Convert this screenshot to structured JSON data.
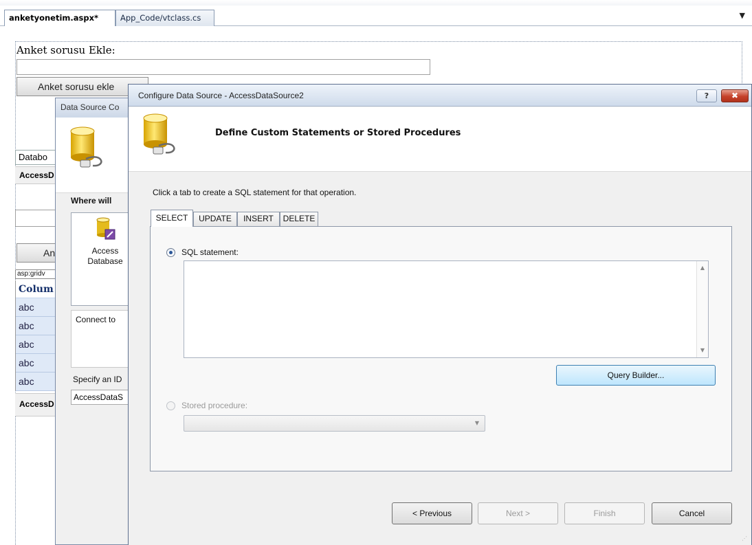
{
  "editor": {
    "tabs": [
      {
        "label": "anketyonetim.aspx*",
        "active": true
      },
      {
        "label": "App_Code/vtclass.cs",
        "active": false
      }
    ],
    "dropdown_glyph": "▼"
  },
  "designer": {
    "question_label": "Anket sorusu Ekle:",
    "add_button_label": "Anket sorusu ekle",
    "datasource_label": "Databo",
    "access_label_1": "AccessD",
    "second_button_label": "An",
    "grid_tag": "asp:gridv",
    "grid_header": "Colum",
    "grid_rows": [
      "abc",
      "abc",
      "abc",
      "abc",
      "abc"
    ],
    "access_label_2": "AccessD"
  },
  "wizard_behind": {
    "title": "Data Source Co",
    "where_label": "Where will",
    "list_item_label_line1": "Access",
    "list_item_label_line2": "Database",
    "description": "Connect to",
    "id_label": "Specify an ID",
    "id_value": "AccessDataS"
  },
  "dialog": {
    "title": "Configure Data Source - AccessDataSource2",
    "help_glyph": "?",
    "close_glyph": "✖",
    "heading": "Define Custom Statements or Stored Procedures",
    "instruction": "Click a tab to create a SQL statement for that operation.",
    "tabs": [
      "SELECT",
      "UPDATE",
      "INSERT",
      "DELETE"
    ],
    "selected_tab": "SELECT",
    "sql_statement_label": "SQL statement:",
    "sql_text": "",
    "query_builder_label": "Query Builder...",
    "stored_procedure_label": "Stored procedure:",
    "stored_procedure_value": "",
    "buttons": {
      "previous": "< Previous",
      "next": "Next >",
      "finish": "Finish",
      "cancel": "Cancel"
    }
  },
  "colors": {
    "accent_blue": "#15306b",
    "grid_row_bg": "#dfe9f7",
    "query_builder_hover": "#bee6fd",
    "close_red": "#c5412a"
  }
}
